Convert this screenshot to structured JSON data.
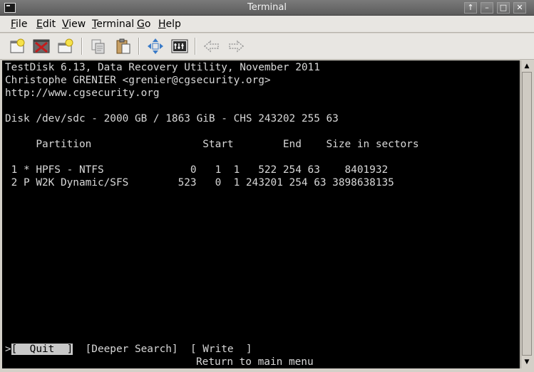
{
  "window": {
    "title": "Terminal",
    "buttons": [
      "↑",
      "–",
      "□",
      "✕"
    ]
  },
  "menubar": {
    "items": [
      {
        "label": "File",
        "mnemonic": "F",
        "rest": "ile"
      },
      {
        "label": "Edit",
        "mnemonic": "E",
        "rest": "dit"
      },
      {
        "label": "View",
        "mnemonic": "V",
        "rest": "iew"
      },
      {
        "label": "Terminal",
        "mnemonic": "T",
        "rest": "erminal"
      },
      {
        "label": "Go",
        "mnemonic": "G",
        "rest": "o"
      },
      {
        "label": "Help",
        "mnemonic": "H",
        "rest": "elp"
      }
    ]
  },
  "toolbar": {
    "icons": [
      "new-window-icon",
      "close-window-icon",
      "new-tab-icon",
      "copy-icon",
      "paste-icon",
      "fullscreen-icon",
      "settings-icon",
      "back-icon",
      "forward-icon"
    ]
  },
  "terminal": {
    "header_line1": "TestDisk 6.13, Data Recovery Utility, November 2011",
    "header_line2": "Christophe GRENIER <grenier@cgsecurity.org>",
    "header_line3": "http://www.cgsecurity.org",
    "disk_line": "Disk /dev/sdc - 2000 GB / 1863 GiB - CHS 243202 255 63",
    "columns_line": "     Partition                  Start        End    Size in sectors",
    "partitions": [
      " 1 * HPFS - NTFS              0   1  1   522 254 63    8401932",
      " 2 P W2K Dynamic/SFS        523   0  1 243201 254 63 3898638135"
    ],
    "menu_prefix": ">",
    "menu_quit": "[  Quit  ]",
    "menu_deeper": "[Deeper Search]",
    "menu_write": "[ Write  ]",
    "help_text": "Return to main menu"
  },
  "colors": {
    "terminal_bg": "#000000",
    "terminal_fg": "#d8d8d8",
    "selection_bg": "#c8c8c8"
  }
}
